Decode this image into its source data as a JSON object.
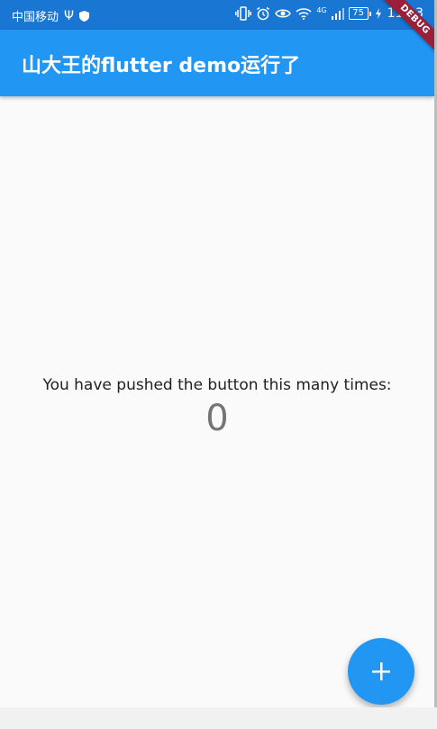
{
  "status_bar": {
    "carrier": "中国移动",
    "network": "4G",
    "battery_level": "75",
    "time": "11:03",
    "icons": [
      "usb-icon",
      "shield-icon",
      "vibrate-icon",
      "alarm-icon",
      "eye-icon",
      "wifi-icon",
      "signal-icon",
      "battery-icon",
      "charging-icon"
    ]
  },
  "app_bar": {
    "title": "山大王的flutter demo运行了"
  },
  "debug_banner": {
    "label": "DEBUG"
  },
  "body": {
    "message": "You have pushed the button this many times:",
    "counter": "0"
  },
  "fab": {
    "icon": "add-icon"
  },
  "colors": {
    "status_bar": "#1976d2",
    "app_bar": "#2196f3",
    "background": "#fafafa",
    "debug_banner": "#9c1f3a",
    "counter_text": "#757575"
  }
}
